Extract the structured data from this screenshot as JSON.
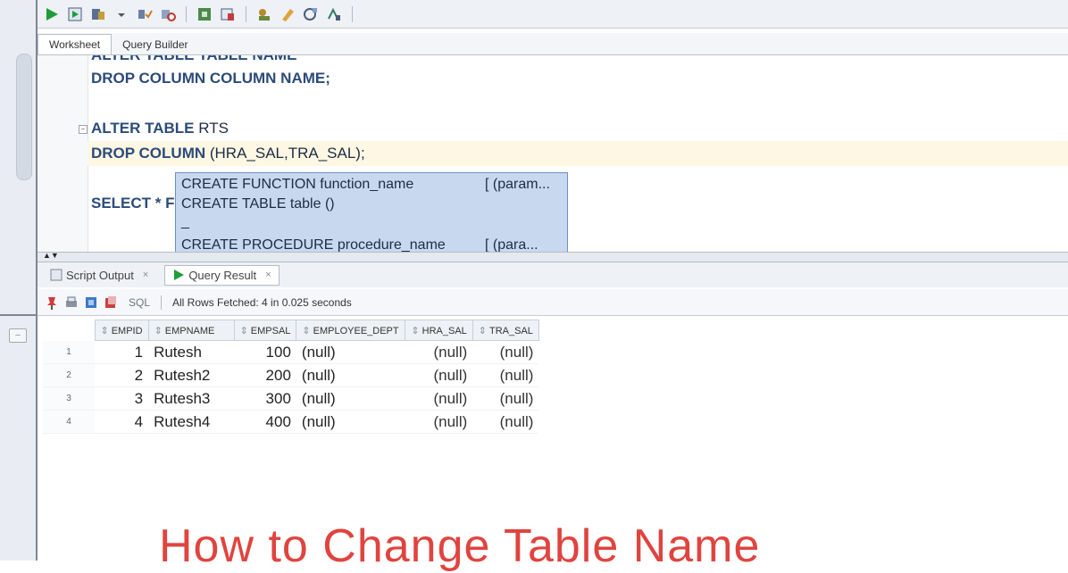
{
  "editor_tabs": [
    "Worksheet",
    "Query Builder"
  ],
  "editor_lines": {
    "line0": "ALTER TABLE TABLE NAME",
    "line1": "DROP COLUMN COLUMN NAME;",
    "line2_kw": "ALTER TABLE ",
    "line2_id": "RTS",
    "line3_kw": "DROP COLUMN ",
    "line3_id": "(HRA_SAL,TRA_SAL);",
    "line4": "SELECT * FI"
  },
  "autocomplete": {
    "items": [
      {
        "label": "CREATE FUNCTION function_name",
        "param": "[ (param..."
      },
      {
        "label": "CREATE TABLE table ()",
        "param": ""
      },
      {
        "label": "_",
        "param": ""
      },
      {
        "label": "CREATE PROCEDURE procedure_name",
        "param": "[ (para..."
      }
    ]
  },
  "result_tabs": [
    {
      "label": "Script Output",
      "close": "×"
    },
    {
      "label": "Query Result",
      "close": "×"
    }
  ],
  "result_toolbar": {
    "sql_label": "SQL",
    "status": "All Rows Fetched: 4 in 0.025 seconds"
  },
  "grid": {
    "columns": [
      "EMPID",
      "EMPNAME",
      "EMPSAL",
      "EMPLOYEE_DEPT",
      "HRA_SAL",
      "TRA_SAL"
    ],
    "rows": [
      {
        "n": "1",
        "empid": "1",
        "empname": "Rutesh",
        "empsal": "100",
        "dept": "(null)",
        "hra": "(null)",
        "tra": "(null)"
      },
      {
        "n": "2",
        "empid": "2",
        "empname": "Rutesh2",
        "empsal": "200",
        "dept": "(null)",
        "hra": "(null)",
        "tra": "(null)"
      },
      {
        "n": "3",
        "empid": "3",
        "empname": "Rutesh3",
        "empsal": "300",
        "dept": "(null)",
        "hra": "(null)",
        "tra": "(null)"
      },
      {
        "n": "4",
        "empid": "4",
        "empname": "Rutesh4",
        "empsal": "400",
        "dept": "(null)",
        "hra": "(null)",
        "tra": "(null)"
      }
    ]
  },
  "caption": "How to Change Table Name",
  "colors": {
    "keyword": "#2c4b7a",
    "caption": "#e0443f",
    "popup": "#c8d9ef"
  }
}
